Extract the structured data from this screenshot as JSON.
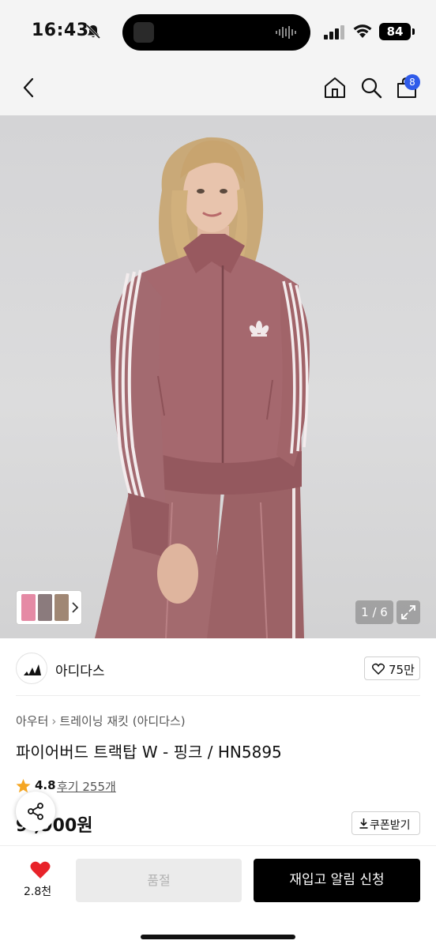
{
  "status_bar": {
    "time": "16:43",
    "battery": "84"
  },
  "nav": {
    "cart_count": "8"
  },
  "gallery": {
    "page_indicator": "1 / 6"
  },
  "brand": {
    "name": "아디다스",
    "like_count": "75만"
  },
  "breadcrumb": {
    "category": "아우터",
    "subcategory": "트레이닝 재킷 (아디다스)"
  },
  "product": {
    "title": "파이어버드 트랙탑 W - 핑크 / HN5895",
    "rating": "4.8",
    "reviews": "후기 255개",
    "price": "9 ,900원"
  },
  "coupon": {
    "label": "쿠폰받기"
  },
  "bottom_bar": {
    "heart_count": "2.8천",
    "soldout_label": "품절",
    "restock_label": "재입고 알림 신청"
  },
  "colors": {
    "accent": "#2f5bea",
    "heart": "#e8232a",
    "star": "#f5a623",
    "jacket": "#a5686e"
  }
}
